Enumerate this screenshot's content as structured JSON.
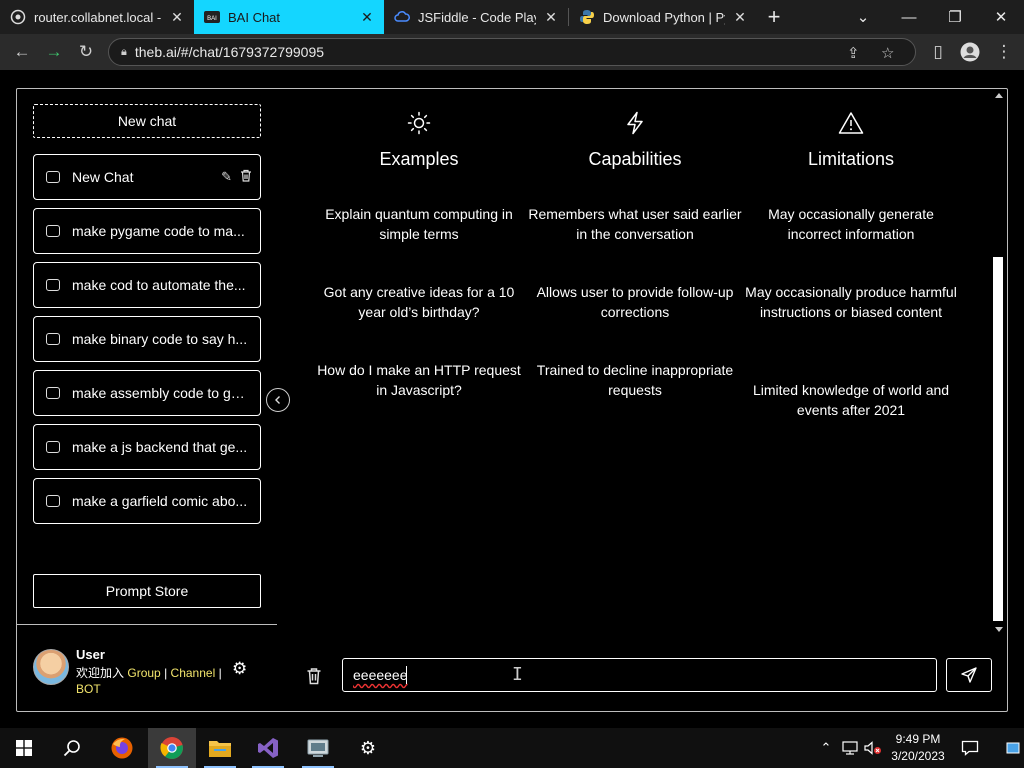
{
  "browser": {
    "tabs": [
      {
        "title": "router.collabnet.local -",
        "active": false
      },
      {
        "title": "BAI Chat",
        "active": true
      },
      {
        "title": "JSFiddle - Code Playgro",
        "active": false
      },
      {
        "title": "Download Python | Pyth",
        "active": false
      }
    ],
    "url": "theb.ai/#/chat/1679372799095"
  },
  "sidebar": {
    "new_chat_label": "New chat",
    "chats": [
      {
        "title": "New Chat"
      },
      {
        "title": "make pygame code to ma..."
      },
      {
        "title": "make cod to automate the..."
      },
      {
        "title": "make binary code to say h..."
      },
      {
        "title": "make assembly code to ge..."
      },
      {
        "title": "make a js backend that ge..."
      },
      {
        "title": "make a garfield comic abo..."
      }
    ],
    "prompt_store_label": "Prompt Store",
    "user": {
      "name": "User",
      "join_text": "欢迎加入",
      "group_link": "Group",
      "separator": "|",
      "channel_link": "Channel",
      "bot_link": "BOT"
    }
  },
  "main": {
    "columns": [
      {
        "title": "Examples",
        "icon": "sun-icon",
        "items": [
          "Explain quantum computing in simple terms",
          "Got any creative ideas for a 10 year old’s birthday?",
          "How do I make an HTTP request in Javascript?"
        ]
      },
      {
        "title": "Capabilities",
        "icon": "lightning-icon",
        "items": [
          "Remembers what user said earlier in the conversation",
          "Allows user to provide follow-up corrections",
          "Trained to decline inappropriate requests"
        ]
      },
      {
        "title": "Limitations",
        "icon": "warning-icon",
        "items": [
          "May occasionally generate incorrect information",
          "May occasionally produce harmful instructions or biased content",
          "Limited knowledge of world and events after 2021"
        ]
      }
    ],
    "composer": {
      "input_value": "eeeeeee"
    }
  },
  "taskbar": {
    "time": "9:49 PM",
    "date": "3/20/2023"
  },
  "colors": {
    "active_tab": "#14d6ff",
    "link_yellow": "#f2e46c",
    "background": "#000000"
  }
}
